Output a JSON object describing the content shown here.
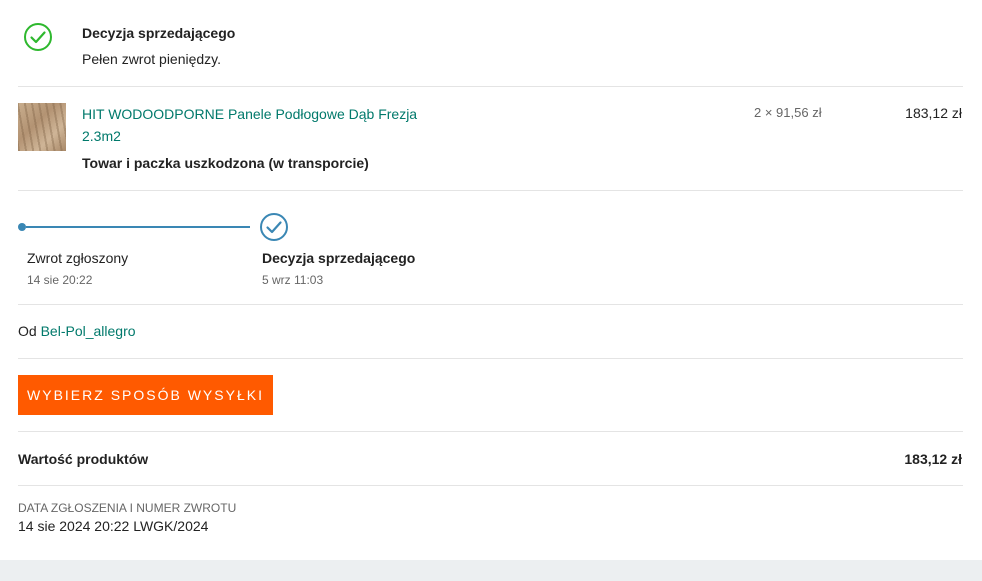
{
  "decision": {
    "title": "Decyzja sprzedającego",
    "subtitle": "Pełen zwrot pieniędzy.",
    "icon": "check-circle-icon",
    "icon_color": "#2eb82e"
  },
  "product": {
    "name": "HIT WODOODPORNE Panele Podłogowe Dąb Frezja 2.3m2",
    "quantity_price": "2 × 91,56 zł",
    "total": "183,12 zł",
    "reason": "Towar i paczka uszkodzona (w transporcie)"
  },
  "timeline": {
    "accent_color": "#3a87b4",
    "steps": [
      {
        "label": "Zwrot zgłoszony",
        "date": "14 sie 20:22"
      },
      {
        "label": "Decyzja sprzedającego",
        "date": "5 wrz 11:03"
      }
    ]
  },
  "seller": {
    "prefix": "Od",
    "name": "Bel-Pol_allegro"
  },
  "shipping_button": {
    "label": "WYBIERZ SPOSÓB WYSYŁKI",
    "color": "#ff5a00"
  },
  "summary": {
    "label": "Wartość produktów",
    "value": "183,12 zł"
  },
  "return_info": {
    "label": "DATA ZGŁOSZENIA I NUMER ZWROTU",
    "value": "14 sie 2024 20:22 LWGK/2024"
  }
}
